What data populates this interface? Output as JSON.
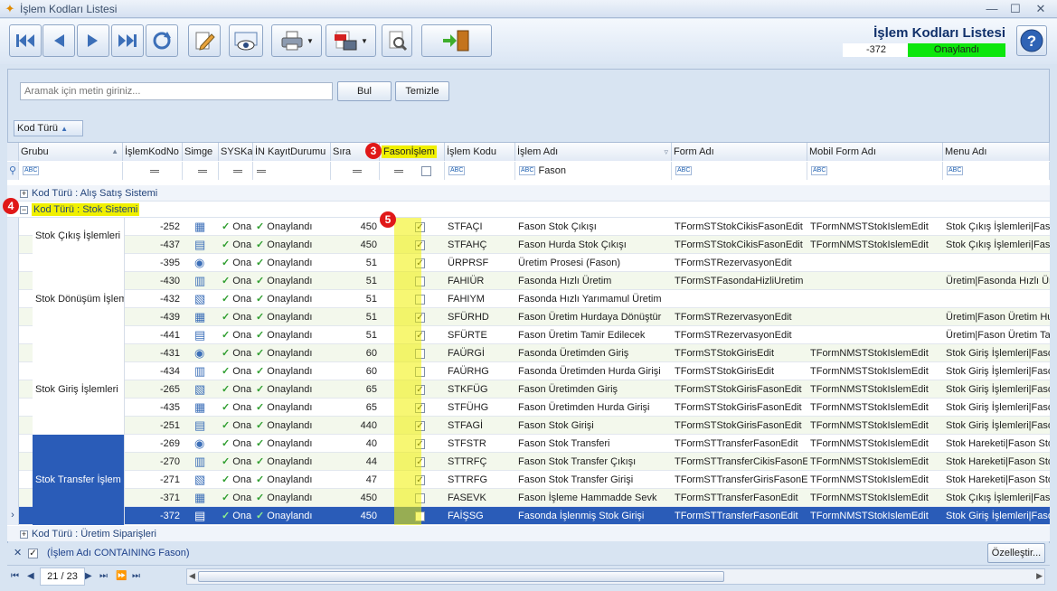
{
  "window": {
    "title": "İşlem Kodları Listesi",
    "minimize": "—",
    "maximize": "☐",
    "close": "✕"
  },
  "header": {
    "heading": "İşlem Kodları Listesi",
    "record_no": "-372",
    "record_status": "Onaylandı",
    "status_color": "#0ce60c"
  },
  "toolbar": {
    "icons": [
      "first-icon",
      "previous-icon",
      "next-icon",
      "last-icon",
      "refresh-icon",
      "edit-icon",
      "preview-icon",
      "print-icon",
      "pdf-export-icon",
      "tools-icon",
      "exit-door-icon",
      "help-icon"
    ]
  },
  "search": {
    "placeholder": "Aramak için metin giriniz...",
    "find_label": "Bul",
    "clear_label": "Temizle"
  },
  "group_panel": {
    "chip": "Kod Türü"
  },
  "columns": [
    "Grubu",
    "İşlemKodNo",
    "Simge",
    "SYSKayıt",
    "İN KayıtDurumu",
    "Sıra",
    "Fasonİşlem",
    "İşlem Kodu",
    "İşlem Adı",
    "Form Adı",
    "Mobil Form Adı",
    "Menu Adı"
  ],
  "filter_row": {
    "islem_adi_filter": "Fason"
  },
  "groups": {
    "g1": "Kod Türü : Alış Satış Sistemi",
    "g2": "Kod Türü : Stok Sistemi",
    "g3": "Kod Türü : Üretim Siparişleri"
  },
  "subgroups": [
    "Stok Çıkış İşlemleri",
    "Stok Dönüşüm İşlem",
    "Stok Giriş İşlemleri",
    "Stok Transfer İşlem"
  ],
  "rows": [
    {
      "no": "-252",
      "sys": "Ona",
      "status": "Onaylandı",
      "sira": "450",
      "fason": true,
      "kod": "STFAÇI",
      "ad": "Fason Stok Çıkışı",
      "form": "TFormSTStokCikisFasonEdit",
      "mobil": "TFormNMSTStokIslemEdit",
      "menu": "Stok Çıkış İşlemleri|Faso"
    },
    {
      "no": "-437",
      "sys": "Ona",
      "status": "Onaylandı",
      "sira": "450",
      "fason": true,
      "kod": "STFAHÇ",
      "ad": "Fason Hurda Stok Çıkışı",
      "form": "TFormSTStokCikisFasonEdit",
      "mobil": "TFormNMSTStokIslemEdit",
      "menu": "Stok Çıkış İşlemleri|Faso"
    },
    {
      "no": "-395",
      "sys": "Ona",
      "status": "Onaylandı",
      "sira": "51",
      "fason": true,
      "kod": "ÜRPRSF",
      "ad": "Üretim Prosesi (Fason)",
      "form": "TFormSTRezervasyonEdit",
      "mobil": "",
      "menu": ""
    },
    {
      "no": "-430",
      "sys": "Ona",
      "status": "Onaylandı",
      "sira": "51",
      "fason": false,
      "kod": "FAHIÜR",
      "ad": "Fasonda Hızlı Üretim",
      "form": "TFormSTFasondaHizliUretim",
      "mobil": "",
      "menu": "Üretim|Fasonda Hızlı Üre"
    },
    {
      "no": "-432",
      "sys": "Ona",
      "status": "Onaylandı",
      "sira": "51",
      "fason": false,
      "kod": "FAHIYM",
      "ad": "Fasonda Hızlı Yarımamul Üretim",
      "form": "",
      "mobil": "",
      "menu": ""
    },
    {
      "no": "-439",
      "sys": "Ona",
      "status": "Onaylandı",
      "sira": "51",
      "fason": true,
      "kod": "SFÜRHD",
      "ad": "Fason Üretim Hurdaya Dönüştür",
      "form": "TFormSTRezervasyonEdit",
      "mobil": "",
      "menu": "Üretim|Fason Üretim Hu"
    },
    {
      "no": "-441",
      "sys": "Ona",
      "status": "Onaylandı",
      "sira": "51",
      "fason": true,
      "kod": "SFÜRTE",
      "ad": "Fason Üretim Tamir Edilecek",
      "form": "TFormSTRezervasyonEdit",
      "mobil": "",
      "menu": "Üretim|Fason Üretim Tam"
    },
    {
      "no": "-431",
      "sys": "Ona",
      "status": "Onaylandı",
      "sira": "60",
      "fason": false,
      "kod": "FAÜRGİ",
      "ad": "Fasonda Üretimden Giriş",
      "form": "TFormSTStokGirisEdit",
      "mobil": "TFormNMSTStokIslemEdit",
      "menu": "Stok Giriş İşlemleri|Faso"
    },
    {
      "no": "-434",
      "sys": "Ona",
      "status": "Onaylandı",
      "sira": "60",
      "fason": false,
      "kod": "FAÜRHG",
      "ad": "Fasonda Üretimden Hurda Girişi",
      "form": "TFormSTStokGirisEdit",
      "mobil": "TFormNMSTStokIslemEdit",
      "menu": "Stok Giriş İşlemleri|Faso"
    },
    {
      "no": "-265",
      "sys": "Ona",
      "status": "Onaylandı",
      "sira": "65",
      "fason": true,
      "kod": "STKFÜG",
      "ad": "Fason Üretimden Giriş",
      "form": "TFormSTStokGirisFasonEdit",
      "mobil": "TFormNMSTStokIslemEdit",
      "menu": "Stok Giriş İşlemleri|Faso"
    },
    {
      "no": "-435",
      "sys": "Ona",
      "status": "Onaylandı",
      "sira": "65",
      "fason": true,
      "kod": "STFÜHG",
      "ad": "Fason Üretimden Hurda Girişi",
      "form": "TFormSTStokGirisFasonEdit",
      "mobil": "TFormNMSTStokIslemEdit",
      "menu": "Stok Giriş İşlemleri|Faso"
    },
    {
      "no": "-251",
      "sys": "Ona",
      "status": "Onaylandı",
      "sira": "440",
      "fason": true,
      "kod": "STFAGİ",
      "ad": "Fason Stok Girişi",
      "form": "TFormSTStokGirisFasonEdit",
      "mobil": "TFormNMSTStokIslemEdit",
      "menu": "Stok Giriş İşlemleri|Faso"
    },
    {
      "no": "-269",
      "sys": "Ona",
      "status": "Onaylandı",
      "sira": "40",
      "fason": true,
      "kod": "STFSTR",
      "ad": "Fason Stok Transferi",
      "form": "TFormSTTransferFasonEdit",
      "mobil": "TFormNMSTStokIslemEdit",
      "menu": "Stok Hareketi|Fason Stok"
    },
    {
      "no": "-270",
      "sys": "Ona",
      "status": "Onaylandı",
      "sira": "44",
      "fason": true,
      "kod": "STTRFÇ",
      "ad": "Fason Stok Transfer Çıkışı",
      "form": "TFormSTTransferCikisFasonEdit",
      "mobil": "TFormNMSTStokIslemEdit",
      "menu": "Stok Hareketi|Fason Stok"
    },
    {
      "no": "-271",
      "sys": "Ona",
      "status": "Onaylandı",
      "sira": "47",
      "fason": true,
      "kod": "STTRFG",
      "ad": "Fason Stok Transfer Girişi",
      "form": "TFormSTTransferGirisFasonEdit",
      "mobil": "TFormNMSTStokIslemEdit",
      "menu": "Stok Hareketi|Fason Stok"
    },
    {
      "no": "-371",
      "sys": "Ona",
      "status": "Onaylandı",
      "sira": "450",
      "fason": false,
      "kod": "FASEVK",
      "ad": "Fason İşleme Hammadde Sevk",
      "form": "TFormSTTransferFasonEdit",
      "mobil": "TFormNMSTStokIslemEdit",
      "menu": "Stok Çıkış İşlemleri|Faso"
    },
    {
      "no": "-372",
      "sys": "Ona",
      "status": "Onaylandı",
      "sira": "450",
      "fason": false,
      "kod": "FAİŞSG",
      "ad": "Fasonda İşlenmiş Stok Girişi",
      "form": "TFormSTTransferFasonEdit",
      "mobil": "TFormNMSTStokIslemEdit",
      "menu": "Stok Giriş İşlemleri|Faso"
    }
  ],
  "badges": {
    "b3": "3",
    "b4": "4",
    "b5": "5"
  },
  "filter_bar": {
    "text": "(İşlem Adı CONTAINING Fason)",
    "customize_label": "Özelleştir..."
  },
  "navigator": {
    "position": "21 / 23"
  },
  "colors": {
    "highlight_yellow": "#f0f000",
    "selected_row": "#2a5cb8",
    "badge_red": "#e01818"
  }
}
